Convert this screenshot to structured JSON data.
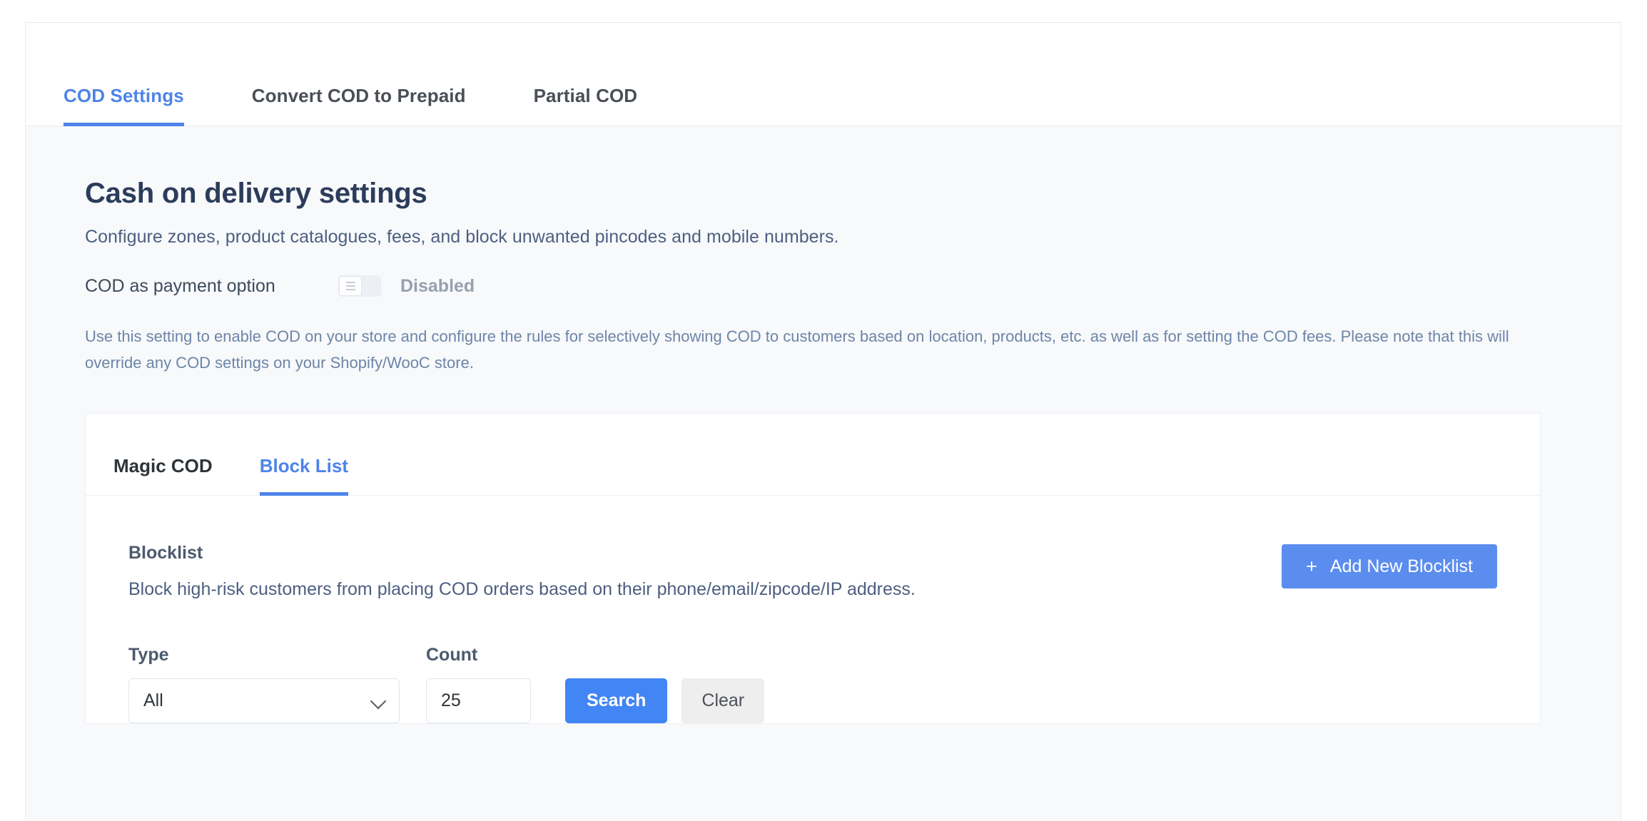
{
  "top_tabs": [
    {
      "label": "COD Settings",
      "active": true
    },
    {
      "label": "Convert COD to Prepaid",
      "active": false
    },
    {
      "label": "Partial COD",
      "active": false
    }
  ],
  "page": {
    "title": "Cash on delivery settings",
    "subtitle": "Configure zones, product catalogues, fees, and block unwanted pincodes and mobile numbers.",
    "cod_toggle_label": "COD as payment option",
    "cod_toggle_state": "Disabled",
    "cod_toggle_on": false,
    "help_text": "Use this setting to enable COD on your store and configure the rules for selectively showing COD to customers based on location, products, etc. as well as for setting the COD fees. Please note that this will override any COD settings on your Shopify/WooC store."
  },
  "card_tabs": [
    {
      "label": "Magic COD",
      "active": false
    },
    {
      "label": "Block List",
      "active": true
    }
  ],
  "blocklist": {
    "title": "Blocklist",
    "description": "Block high-risk customers from placing COD orders based on their phone/email/zipcode/IP address.",
    "add_button_label": "Add New Blocklist",
    "add_button_icon": "plus-icon"
  },
  "filters": {
    "type_label": "Type",
    "type_value": "All",
    "type_options": [
      "All"
    ],
    "count_label": "Count",
    "count_value": "25",
    "count_placeholder": "",
    "search_label": "Search",
    "clear_label": "Clear"
  },
  "colors": {
    "accent_blue": "#4e84ea",
    "button_blue": "#4285f4",
    "add_button_blue": "#5b8def",
    "heading_navy": "#2c3c5b",
    "muted_blue": "#6e85a8",
    "page_bg": "#f7f9fb"
  }
}
